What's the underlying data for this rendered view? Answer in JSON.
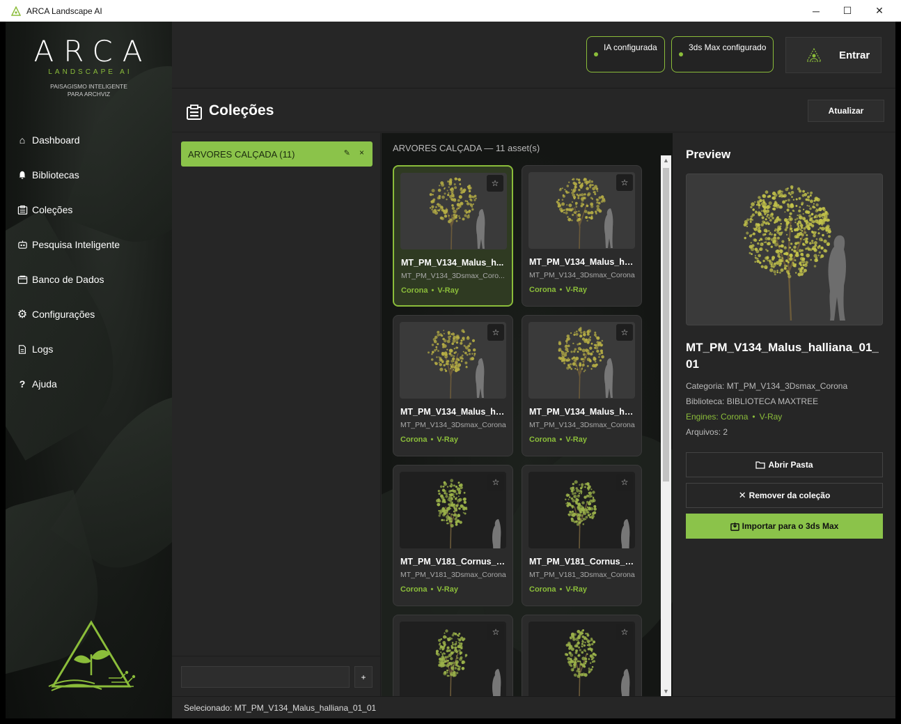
{
  "window": {
    "title": "ARCA Landscape AI",
    "controls": {
      "minimize": "─",
      "maximize": "☐",
      "close": "✕"
    }
  },
  "colors": {
    "accent": "#8bc34a",
    "accent_text": "#8bbd3a",
    "bg": "#262626",
    "panel": "#2b2b2b"
  },
  "sidebar": {
    "logo_word": "ARCA",
    "logo_sub": "LANDSCAPE AI",
    "tagline_1": "PAISAGISMO INTELIGENTE",
    "tagline_2": "PARA ARCHVIZ",
    "items": [
      {
        "label": "Dashboard",
        "icon": "home-icon",
        "glyph": "⌂"
      },
      {
        "label": "Bibliotecas",
        "icon": "bell-icon",
        "glyph": "🔔"
      },
      {
        "label": "Coleções",
        "icon": "collection-icon",
        "glyph": "▤"
      },
      {
        "label": "Pesquisa Inteligente",
        "icon": "robot-icon",
        "glyph": "◉"
      },
      {
        "label": "Banco de Dados",
        "icon": "database-icon",
        "glyph": "▭"
      },
      {
        "label": "Configurações",
        "icon": "gear-icon",
        "glyph": "⚙"
      },
      {
        "label": "Logs",
        "icon": "document-icon",
        "glyph": "▯"
      },
      {
        "label": "Ajuda",
        "icon": "help-icon",
        "glyph": "?"
      }
    ]
  },
  "header": {
    "status_ai": "IA configurada",
    "status_max": "3ds Max configurado",
    "login_label": "Entrar"
  },
  "page": {
    "title": "Coleções",
    "refresh_label": "Atualizar"
  },
  "collections": {
    "items": [
      {
        "label": "ARVORES CALÇADA (11)",
        "edit_glyph": "✎",
        "remove_glyph": "×"
      }
    ],
    "new_placeholder": "",
    "add_label": "+"
  },
  "assets": {
    "heading": "ARVORES CALÇADA — 11 asset(s)",
    "star_glyph": "☆",
    "engine_sep": "•",
    "cards": [
      {
        "name": "MT_PM_V134_Malus_h...",
        "category": "MT_PM_V134_3Dsmax_Coro...",
        "engine_1": "Corona",
        "engine_2": "V-Ray",
        "selected": true,
        "dark": false
      },
      {
        "name": "MT_PM_V134_Malus_ha...",
        "category": "MT_PM_V134_3Dsmax_Corona",
        "engine_1": "Corona",
        "engine_2": "V-Ray",
        "selected": false,
        "dark": false
      },
      {
        "name": "MT_PM_V134_Malus_ha...",
        "category": "MT_PM_V134_3Dsmax_Corona",
        "engine_1": "Corona",
        "engine_2": "V-Ray",
        "selected": false,
        "dark": false
      },
      {
        "name": "MT_PM_V134_Malus_ha...",
        "category": "MT_PM_V134_3Dsmax_Corona",
        "engine_1": "Corona",
        "engine_2": "V-Ray",
        "selected": false,
        "dark": false
      },
      {
        "name": "MT_PM_V181_Cornus_k...",
        "category": "MT_PM_V181_3Dsmax_Corona",
        "engine_1": "Corona",
        "engine_2": "V-Ray",
        "selected": false,
        "dark": true
      },
      {
        "name": "MT_PM_V181_Cornus_k...",
        "category": "MT_PM_V181_3Dsmax_Corona",
        "engine_1": "Corona",
        "engine_2": "V-Ray",
        "selected": false,
        "dark": true
      },
      {
        "name": "",
        "category": "",
        "engine_1": "",
        "engine_2": "",
        "selected": false,
        "dark": true
      },
      {
        "name": "",
        "category": "",
        "engine_1": "",
        "engine_2": "",
        "selected": false,
        "dark": true
      }
    ]
  },
  "preview": {
    "title": "Preview",
    "name": "MT_PM_V134_Malus_halliana_01_01",
    "category_label": "Categoria:",
    "category": "MT_PM_V134_3Dsmax_Corona",
    "library_label": "Biblioteca:",
    "library": "BIBLIOTECA MAXTREE",
    "engines_label": "Engines:",
    "engine_1": "Corona",
    "engine_2": "V-Ray",
    "files_label": "Arquivos:",
    "files": "2",
    "open_folder": "Abrir Pasta",
    "remove": "Remover da coleção",
    "import": "Importar para o 3ds Max"
  },
  "statusbar": {
    "text": "Selecionado: MT_PM_V134_Malus_halliana_01_01"
  }
}
